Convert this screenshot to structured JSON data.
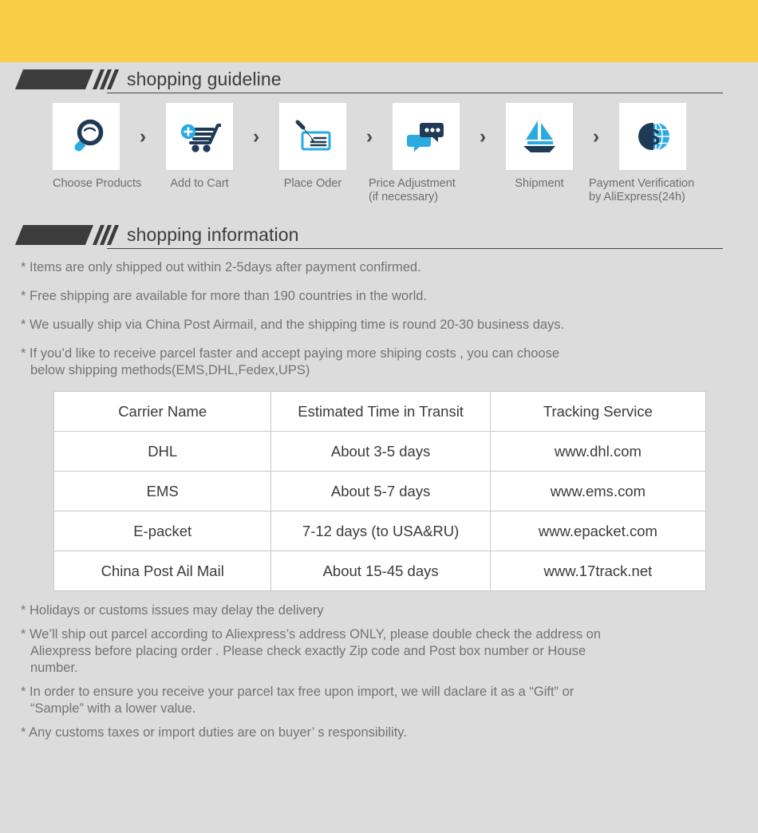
{
  "theme": {
    "band_color": "#F7CE46",
    "page_background": "#DCDCDC",
    "heading_color": "#3C3C3C",
    "body_text_color": "#737373",
    "icon_dark": "#1F3A56",
    "icon_cyan": "#29ABE2",
    "table_border": "#C9C9C9",
    "table_background": "#FFFFFF"
  },
  "guideline": {
    "title": "shopping guideline",
    "separator": "›",
    "steps": [
      {
        "icon": "magnifier-icon",
        "label": "Choose Products"
      },
      {
        "icon": "add-to-cart-icon",
        "label": "Add to Cart"
      },
      {
        "icon": "pen-signing-icon",
        "label": "Place Oder"
      },
      {
        "icon": "chat-bubbles-icon",
        "label_line1": "Price Adjustment",
        "label_line2": "(if necessary)"
      },
      {
        "icon": "sailboat-icon",
        "label": "Shipment"
      },
      {
        "icon": "dollar-globe-icon",
        "label_line1": "Payment Verification",
        "label_line2": "by AliExpress(24h)"
      }
    ]
  },
  "information": {
    "title": "shopping information",
    "bullets_top": [
      {
        "text": "* Items are only shipped out within 2-5days after payment confirmed."
      },
      {
        "text": "* Free shipping are available for more than 190 countries in the world."
      },
      {
        "text": "* We usually ship via China Post Airmail, and the shipping time is round 20-30 business days."
      },
      {
        "text": "* If you’d like to receive parcel faster and accept paying more shiping costs , you can choose",
        "cont": "below shipping methods(EMS,DHL,Fedex,UPS)"
      }
    ],
    "table": {
      "headers": [
        "Carrier Name",
        "Estimated Time in Transit",
        "Tracking Service"
      ],
      "rows": [
        [
          "DHL",
          "About 3-5 days",
          "www.dhl.com"
        ],
        [
          "EMS",
          "About 5-7 days",
          "www.ems.com"
        ],
        [
          "E-packet",
          "7-12 days (to USA&RU)",
          "www.epacket.com"
        ],
        [
          "China Post Ail Mail",
          "About 15-45 days",
          "www.17track.net"
        ]
      ]
    },
    "bullets_bottom": [
      {
        "text": "* Holidays or customs issues may delay the delivery"
      },
      {
        "text": "* We’ll ship out parcel according to Aliexpress’s address ONLY, please double check the address on",
        "cont": "Aliexpress before placing order . Please check exactly Zip code and Post box  number or House",
        "cont2": "number."
      },
      {
        "text": "* In order to ensure you receive your parcel tax free upon import, we will daclare it as a  “Gift”  or",
        "cont": "“Sample”  with a lower value."
      },
      {
        "text": "* Any customs taxes or import duties are on buyer’ s responsibility."
      }
    ]
  }
}
